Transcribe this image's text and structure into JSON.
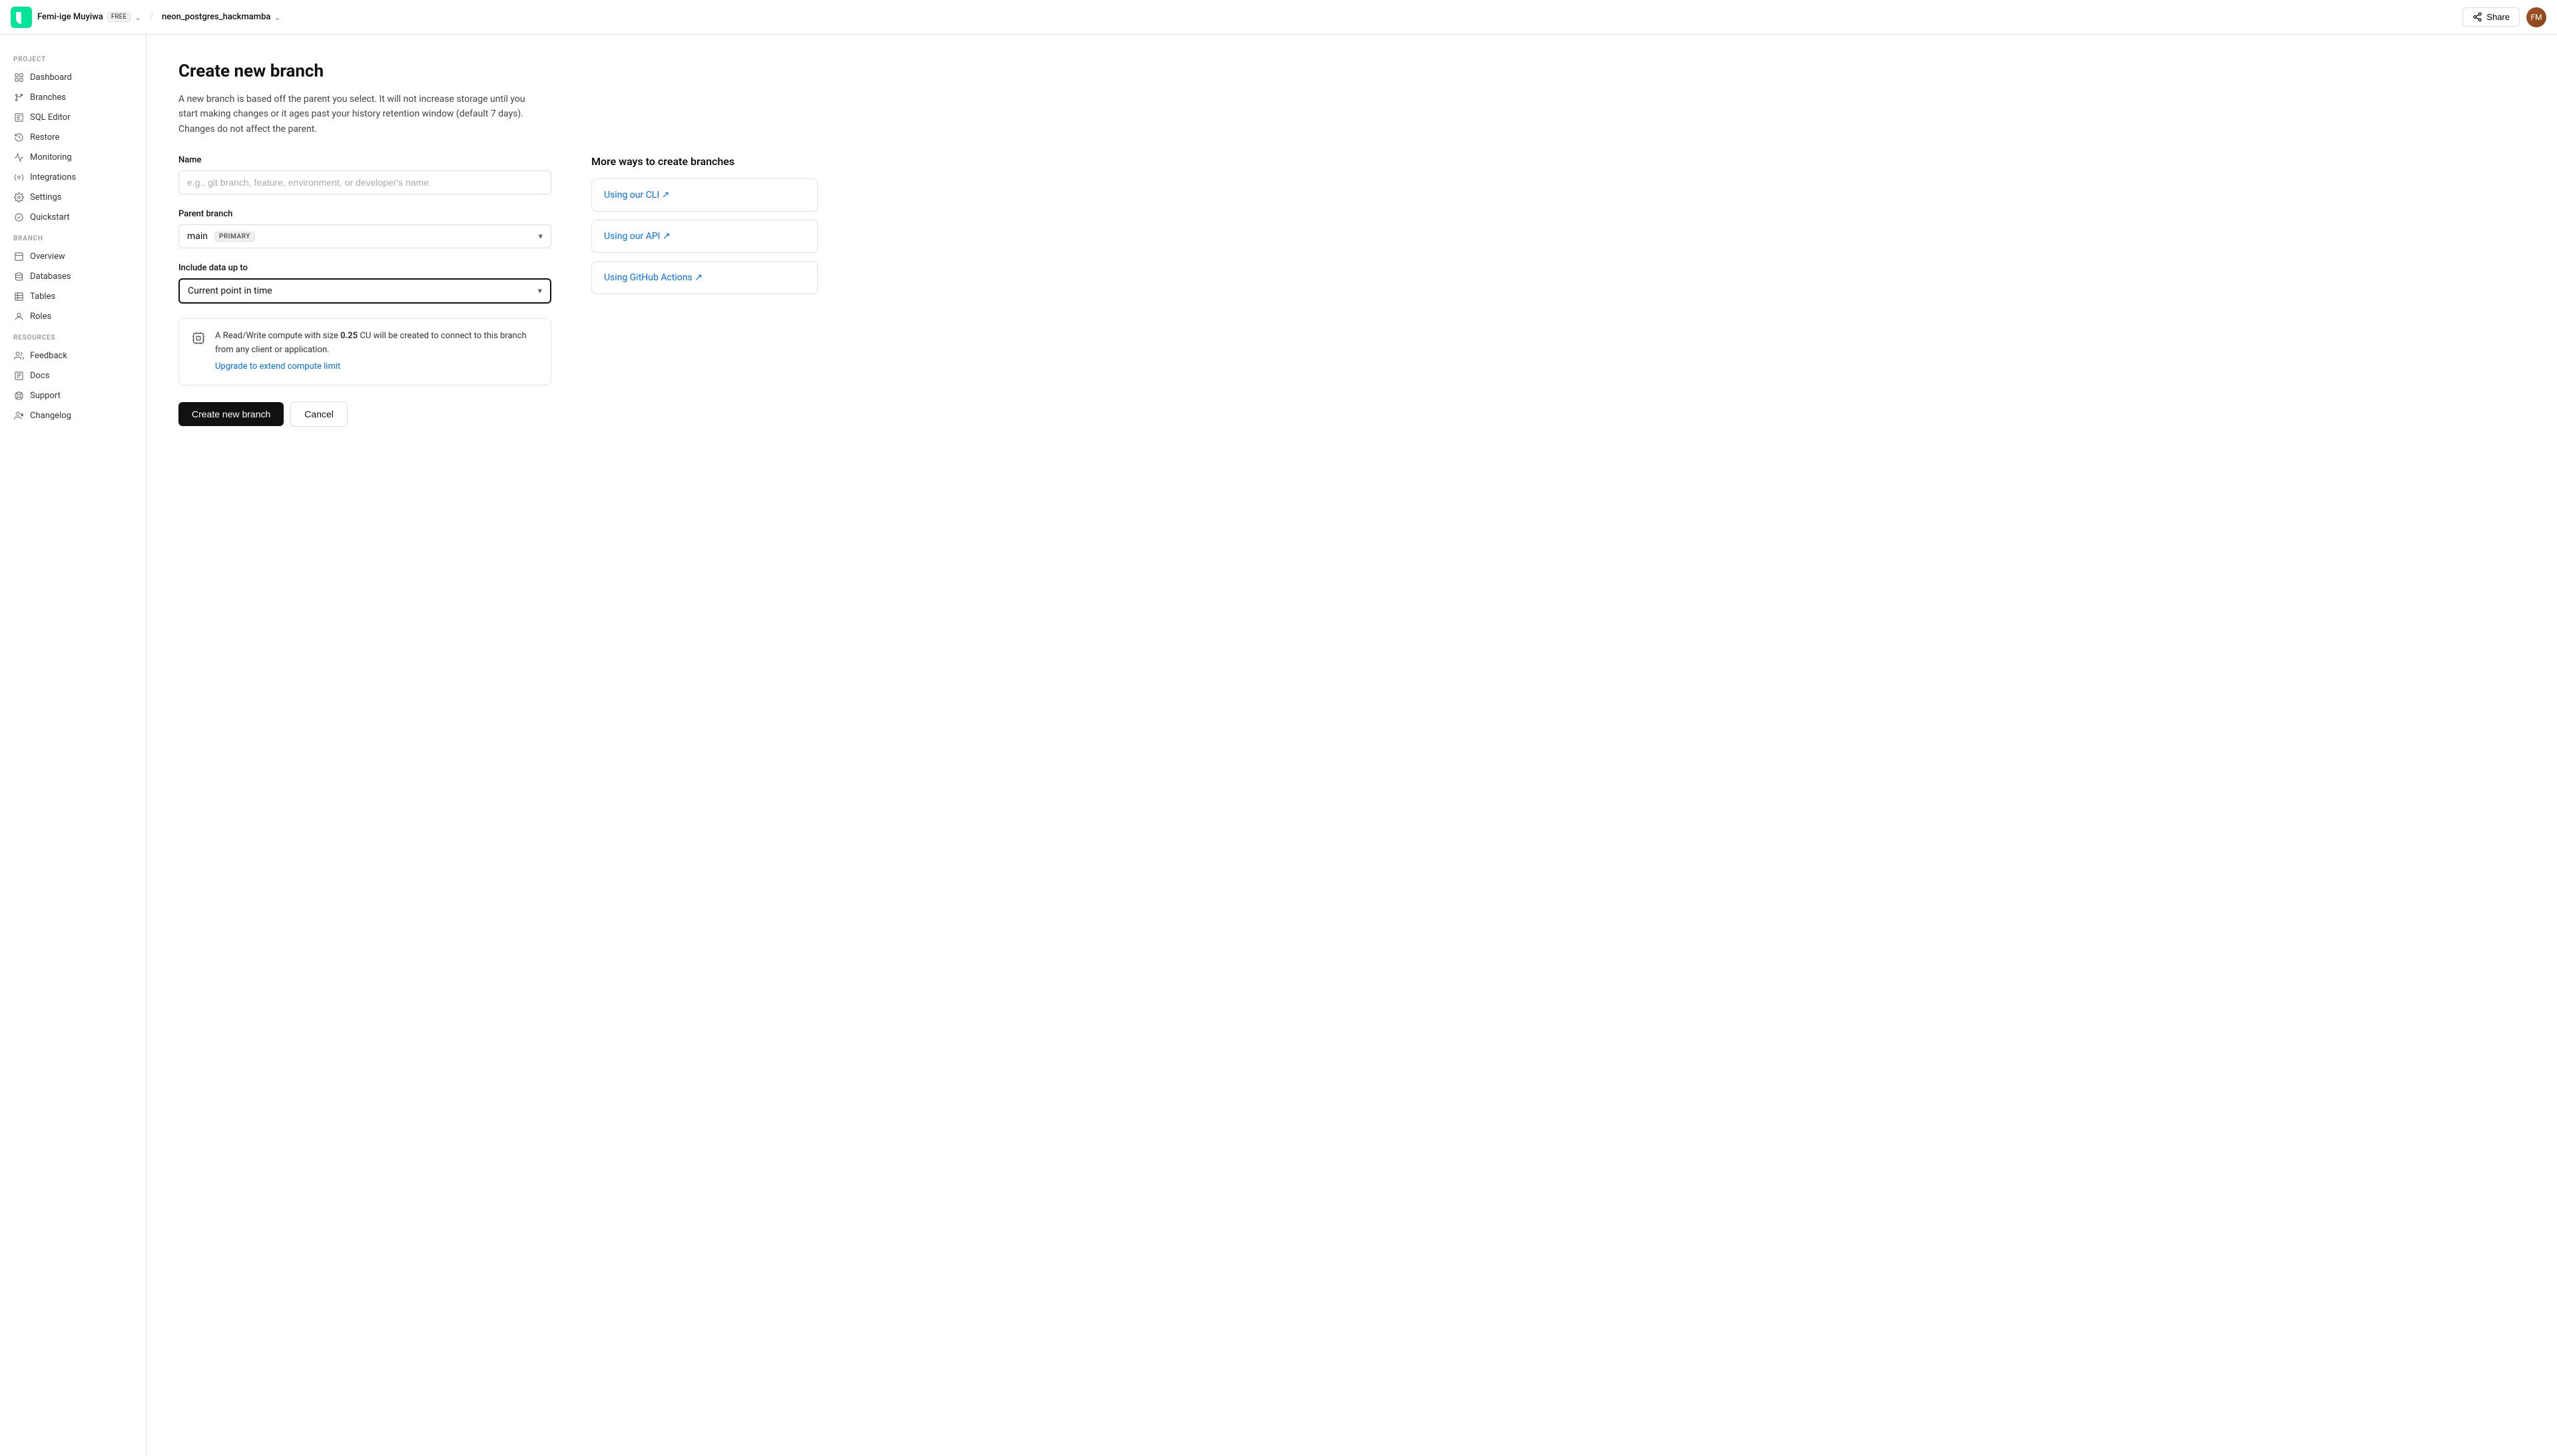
{
  "topnav": {
    "logo_alt": "Neon logo",
    "user_name": "Femi-ige Muyiwa",
    "user_badge": "FREE",
    "project_name": "neon_postgres_hackmamba",
    "share_label": "Share"
  },
  "sidebar": {
    "project_section": "PROJECT",
    "branch_section": "BRANCH",
    "resources_section": "RESOURCES",
    "project_items": [
      {
        "id": "dashboard",
        "label": "Dashboard"
      },
      {
        "id": "branches",
        "label": "Branches"
      },
      {
        "id": "sql-editor",
        "label": "SQL Editor"
      },
      {
        "id": "restore",
        "label": "Restore"
      },
      {
        "id": "monitoring",
        "label": "Monitoring"
      },
      {
        "id": "integrations",
        "label": "Integrations"
      },
      {
        "id": "settings",
        "label": "Settings"
      },
      {
        "id": "quickstart",
        "label": "Quickstart"
      }
    ],
    "branch_items": [
      {
        "id": "overview",
        "label": "Overview"
      },
      {
        "id": "databases",
        "label": "Databases"
      },
      {
        "id": "tables",
        "label": "Tables"
      },
      {
        "id": "roles",
        "label": "Roles"
      }
    ],
    "resource_items": [
      {
        "id": "feedback",
        "label": "Feedback"
      },
      {
        "id": "docs",
        "label": "Docs"
      },
      {
        "id": "support",
        "label": "Support"
      },
      {
        "id": "changelog",
        "label": "Changelog"
      }
    ]
  },
  "page": {
    "title": "Create new branch",
    "description": "A new branch is based off the parent you select. It will not increase storage until you start making changes or it ages past your history retention window (default 7 days). Changes do not affect the parent.",
    "name_label": "Name",
    "name_placeholder": "e.g., git branch, feature, environment, or developer's name",
    "parent_branch_label": "Parent branch",
    "parent_branch_value": "main",
    "primary_badge": "PRIMARY",
    "include_data_label": "Include data up to",
    "include_data_value": "Current point in time",
    "info_text_prefix": "A Read/Write compute with size ",
    "info_text_size": "0.25",
    "info_text_suffix": " CU will be created to connect to this branch from any client or application.",
    "upgrade_link": "Upgrade to extend compute limit",
    "create_btn": "Create new branch",
    "cancel_btn": "Cancel"
  },
  "aside": {
    "title": "More ways to create branches",
    "cards": [
      {
        "id": "cli",
        "label": "Using our CLI ↗"
      },
      {
        "id": "api",
        "label": "Using our API ↗"
      },
      {
        "id": "github",
        "label": "Using GitHub Actions ↗"
      }
    ]
  }
}
